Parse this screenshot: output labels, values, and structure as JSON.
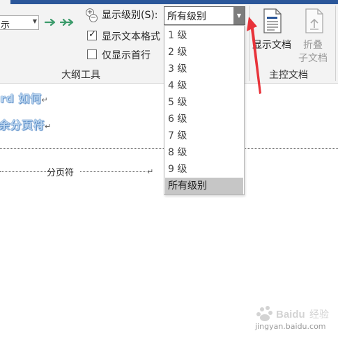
{
  "colors": {
    "ribbon_bg": "#f3f3f3",
    "title_bar": "#2b579a",
    "arrow_green": "#3c9b6b",
    "red_pointer": "#e8333a",
    "selected_bg": "#c6c6c6"
  },
  "outline_tools": {
    "level_combo_value": "示",
    "promote_icon": "arrow-right-green-icon",
    "promote_to_body_icon": "double-arrow-right-green-icon",
    "show_level_label": "显示级别(S):",
    "show_level_value": "所有级别",
    "show_text_format_label": "显示文本格式",
    "show_text_format_checked": true,
    "show_first_line_label": "仅显示首行",
    "show_first_line_checked": false,
    "group_label": "大纲工具"
  },
  "master_document": {
    "show_document_label": "显示文档",
    "collapse_subdocs_label_line1": "折叠",
    "collapse_subdocs_label_line2": "子文档",
    "group_label": "主控文档"
  },
  "level_dropdown": {
    "options": [
      "1 级",
      "2 级",
      "3 级",
      "4 级",
      "5 级",
      "6 级",
      "7 级",
      "8 级",
      "9 级",
      "所有级别"
    ],
    "selected": "所有级别"
  },
  "document": {
    "line1": "rd 如何",
    "line2": "余分页符",
    "paragraph_mark": "↵",
    "page_break_label": "分页符"
  },
  "watermark": {
    "site": "Baidu",
    "text": "jingyan.baidu.com"
  }
}
